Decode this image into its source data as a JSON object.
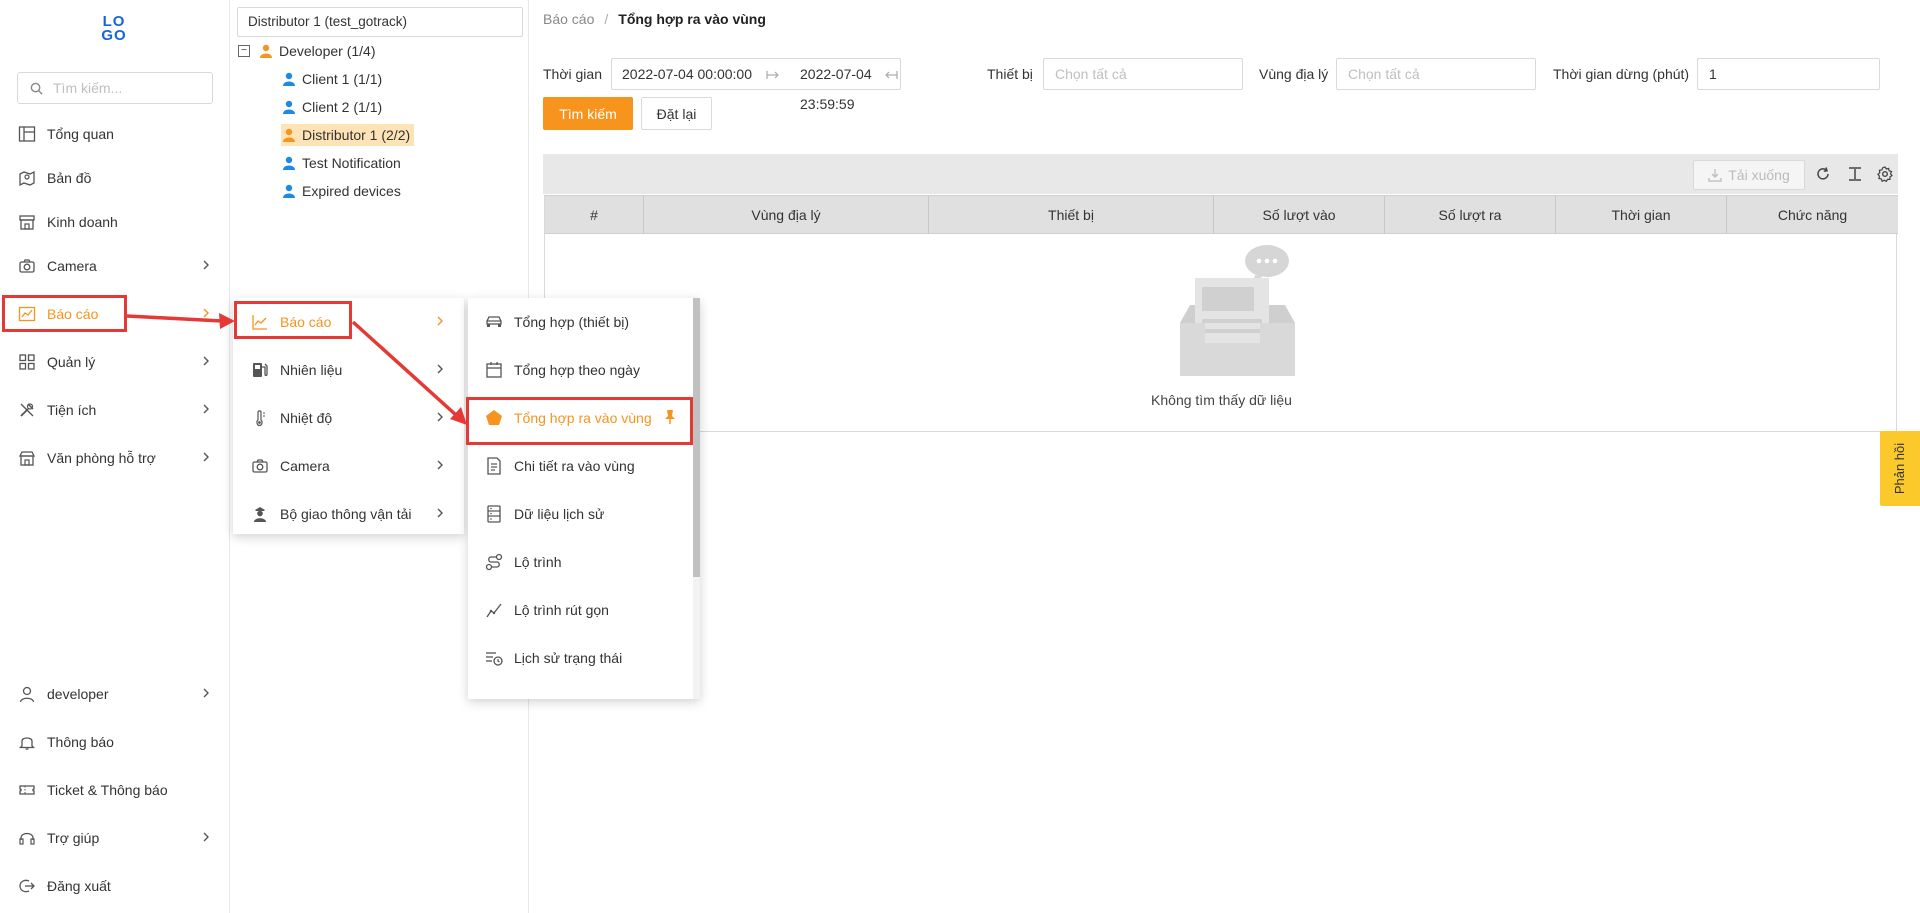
{
  "logo": {
    "line1": "LO",
    "line2": "GO"
  },
  "sidebar": {
    "search_placeholder": "Tìm kiếm...",
    "items": [
      {
        "label": "Tổng quan",
        "icon": "layout-icon"
      },
      {
        "label": "Bản đồ",
        "icon": "map-icon"
      },
      {
        "label": "Kinh doanh",
        "icon": "store-icon"
      },
      {
        "label": "Camera",
        "icon": "camera-icon"
      },
      {
        "label": "Báo cáo",
        "icon": "chart-icon"
      },
      {
        "label": "Quản lý",
        "icon": "grid-icon"
      },
      {
        "label": "Tiện ích",
        "icon": "tools-icon"
      },
      {
        "label": "Văn phòng hỗ trợ",
        "icon": "office-icon"
      }
    ],
    "bottom": [
      {
        "label": "developer",
        "icon": "user-icon"
      },
      {
        "label": "Thông báo",
        "icon": "bell-icon"
      },
      {
        "label": "Ticket & Thông báo",
        "icon": "ticket-icon"
      },
      {
        "label": "Trợ giúp",
        "icon": "headset-icon"
      },
      {
        "label": "Đăng xuất",
        "icon": "logout-icon"
      }
    ]
  },
  "tree": {
    "selector": "Distributor 1 (test_gotrack)",
    "root": "Developer (1/4)",
    "children": [
      "Client 1 (1/1)",
      "Client 2 (1/1)",
      "Distributor 1 (2/2)",
      "Test Notification",
      "Expired devices"
    ]
  },
  "breadcrumb": {
    "parent": "Báo cáo",
    "separator": "/",
    "current": "Tổng hợp ra vào vùng"
  },
  "filters": {
    "time_label": "Thời gian",
    "time_start": "2022-07-04 00:00:00",
    "time_end": "2022-07-04 23:59:59",
    "device_label": "Thiết bị",
    "device_placeholder": "Chọn tất cả",
    "zone_label": "Vùng địa lý",
    "zone_placeholder": "Chọn tất cả",
    "stop_label": "Thời gian dừng (phút)",
    "stop_value": "1"
  },
  "buttons": {
    "search": "Tìm kiếm",
    "reset": "Đặt lại",
    "download": "Tải xuống"
  },
  "table": {
    "columns": [
      "#",
      "Vùng địa lý",
      "Thiết bị",
      "Số lượt vào",
      "Số lượt ra",
      "Thời gian",
      "Chức năng"
    ],
    "empty": "Không tìm thấy dữ liệu"
  },
  "feedback": "Phản hồi",
  "menu1": [
    {
      "label": "Báo cáo",
      "icon": "chart-icon"
    },
    {
      "label": "Nhiên liệu",
      "icon": "fuel-icon"
    },
    {
      "label": "Nhiệt độ",
      "icon": "thermometer-icon"
    },
    {
      "label": "Camera",
      "icon": "camera-icon"
    },
    {
      "label": "Bộ giao thông vận tải",
      "icon": "officer-icon"
    }
  ],
  "menu2": [
    {
      "label": "Tổng hợp (thiết bị)",
      "icon": "car-icon"
    },
    {
      "label": "Tổng hợp theo ngày",
      "icon": "calendar-icon"
    },
    {
      "label": "Tổng hợp ra vào vùng",
      "icon": "pentagon-icon"
    },
    {
      "label": "Chi tiết ra vào vùng",
      "icon": "document-icon"
    },
    {
      "label": "Dữ liệu lịch sử",
      "icon": "database-icon"
    },
    {
      "label": "Lộ trình",
      "icon": "route-icon"
    },
    {
      "label": "Lộ trình rút gọn",
      "icon": "line-chart-icon"
    },
    {
      "label": "Lịch sử trạng thái",
      "icon": "history-icon"
    }
  ],
  "colors": {
    "accent": "#f7941d",
    "highlight": "#e53935",
    "brand": "#1565d8",
    "feedback": "#fbc92b"
  }
}
